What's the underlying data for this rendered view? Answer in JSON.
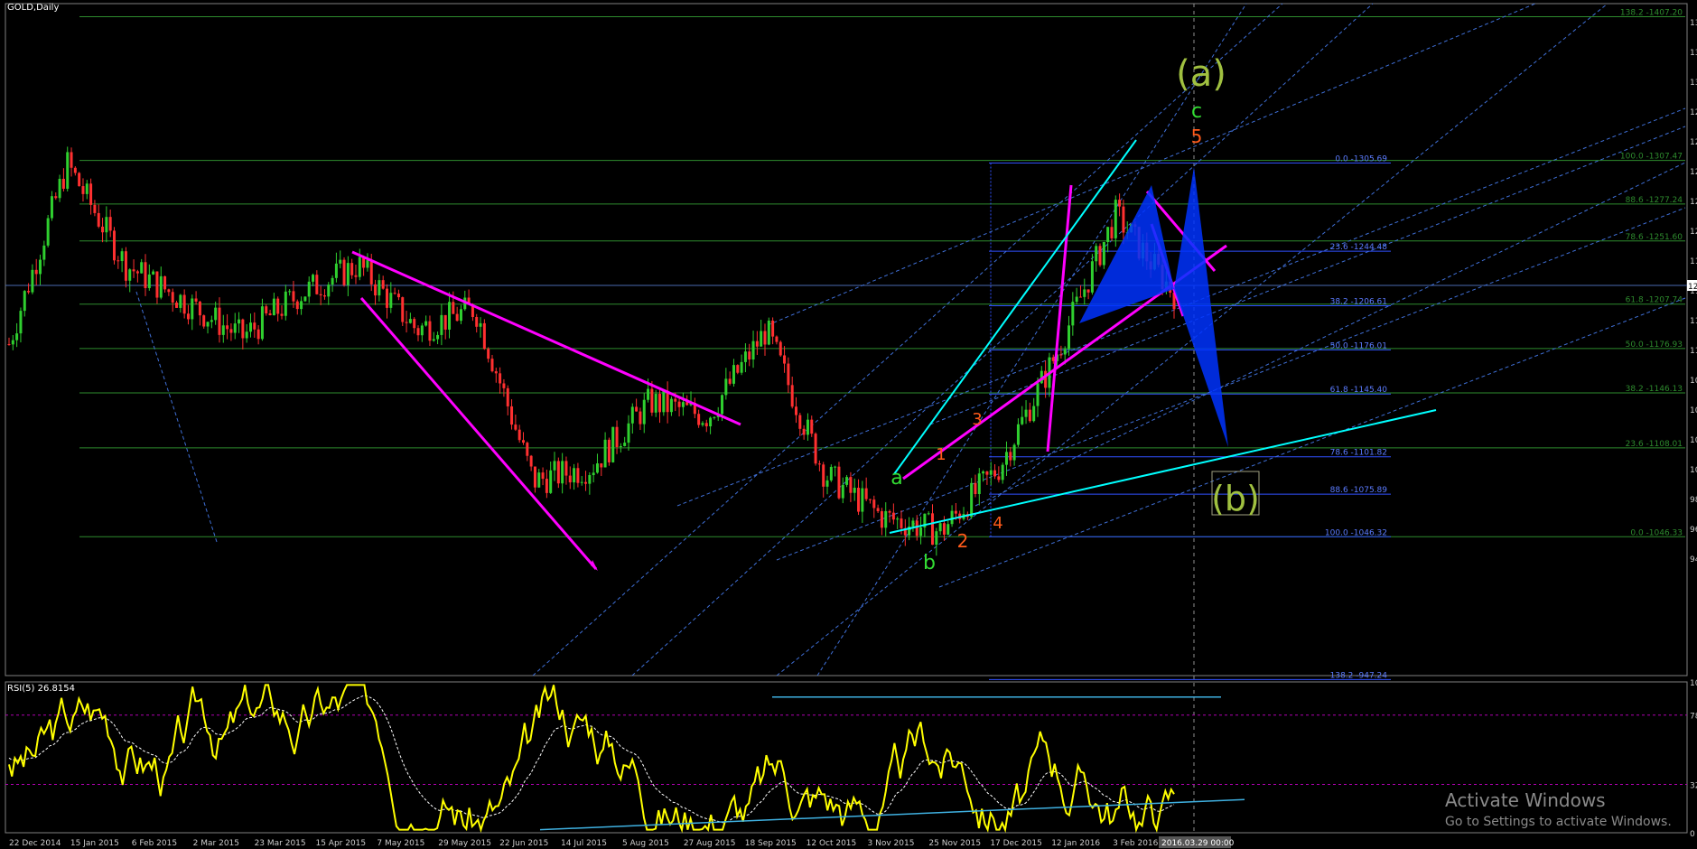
{
  "chart_title": "GOLD,Daily",
  "rsi_title": "RSI(5) 26.8154",
  "watermark": {
    "line1": "Activate Windows",
    "line2": "Go to Settings to activate Windows."
  },
  "colors": {
    "background": "#000000",
    "bull": "#2fcf2f",
    "bear": "#ff3030",
    "magenta": "#ff00ff",
    "cyan": "#00ffff",
    "fib_left": "#2e8b2e",
    "fib_right": "#3050ff",
    "triangle": "#0033ff",
    "rsi": "#ffff00",
    "wave_green": "#33dd33",
    "wave_orange": "#ff5a1a",
    "wave_big": "#a0c040"
  },
  "chart_data": {
    "type": "candlestick",
    "symbol": "GOLD",
    "timeframe": "Daily",
    "x_labels": [
      "22 Dec 2014",
      "15 Jan 2015",
      "6 Feb 2015",
      "2 Mar 2015",
      "23 Mar 2015",
      "15 Apr 2015",
      "7 May 2015",
      "29 May 2015",
      "22 Jun 2015",
      "14 Jul 2015",
      "5 Aug 2015",
      "27 Aug 2015",
      "18 Sep 2015",
      "12 Oct 2015",
      "3 Nov 2015",
      "25 Nov 2015",
      "17 Dec 2015",
      "12 Jan 2016",
      "3 Feb 2016",
      "25 Feb 2016"
    ],
    "cursor_date": "2016.03.29 00:00",
    "y_labels": [
      "13",
      "13",
      "13",
      "12",
      "12",
      "12",
      "12",
      "12",
      "11",
      "11",
      "11",
      "11",
      "10",
      "10",
      "10",
      "10",
      "98",
      "96",
      "94"
    ],
    "price_label": "12",
    "price_series": [
      [
        "22 Dec 2014",
        1180
      ],
      [
        "15 Jan 2015",
        1305
      ],
      [
        "6 Feb 2015",
        1235
      ],
      [
        "2 Mar 2015",
        1210
      ],
      [
        "23 Mar 2015",
        1185
      ],
      [
        "15 Apr 2015",
        1215
      ],
      [
        "7 May 2015",
        1235
      ],
      [
        "29 May 2015",
        1190
      ],
      [
        "22 Jun 2015",
        1205
      ],
      [
        "14 Jul 2015",
        1085
      ],
      [
        "5 Aug 2015",
        1095
      ],
      [
        "27 Aug 2015",
        1140
      ],
      [
        "18 Sep 2015",
        1130
      ],
      [
        "12 Oct 2015",
        1190
      ],
      [
        "3 Nov 2015",
        1090
      ],
      [
        "25 Nov 2015",
        1060
      ],
      [
        "17 Dec 2015",
        1050
      ],
      [
        "12 Jan 2016",
        1095
      ],
      [
        "3 Feb 2016",
        1175
      ],
      [
        "25 Feb 2016",
        1270
      ],
      [
        "2016.03.29",
        1215
      ]
    ],
    "fib_left": [
      {
        "label": "138.2 -1407.20",
        "color": "green"
      },
      {
        "label": "100.0 -1307.47",
        "color": "green"
      },
      {
        "label": "88.6 -1277.24",
        "color": "green"
      },
      {
        "label": "78.6 -1251.60",
        "color": "green"
      },
      {
        "label": "61.8 -1207.74",
        "color": "green"
      },
      {
        "label": "50.0 -1176.93",
        "color": "green"
      },
      {
        "label": "38.2 -1146.13",
        "color": "green"
      },
      {
        "label": "23.6 -1108.01",
        "color": "green"
      },
      {
        "label": "0.0 -1046.33",
        "color": "green"
      }
    ],
    "fib_right": [
      {
        "label": "0.0 -1305.69"
      },
      {
        "label": "23.6 -1244.48"
      },
      {
        "label": "38.2 -1206.61"
      },
      {
        "label": "50.0 -1176.01"
      },
      {
        "label": "61.8 -1145.40"
      },
      {
        "label": "78.6 -1101.82"
      },
      {
        "label": "88.6 -1075.89"
      },
      {
        "label": "100.0 -1046.32"
      },
      {
        "label": "138.2 -947.24"
      }
    ],
    "wave_labels": [
      {
        "text": "(a)",
        "color": "big"
      },
      {
        "text": "c",
        "color": "green"
      },
      {
        "text": "5",
        "color": "orange"
      },
      {
        "text": "3",
        "color": "orange"
      },
      {
        "text": "1",
        "color": "orange"
      },
      {
        "text": "a",
        "color": "green"
      },
      {
        "text": "4",
        "color": "orange"
      },
      {
        "text": "2",
        "color": "orange"
      },
      {
        "text": "b",
        "color": "green"
      },
      {
        "text": "(b)",
        "color": "big"
      }
    ],
    "rsi": {
      "period": 5,
      "value": 26.8154,
      "levels_labels": [
        "100",
        "78",
        "32",
        "0"
      ]
    }
  }
}
